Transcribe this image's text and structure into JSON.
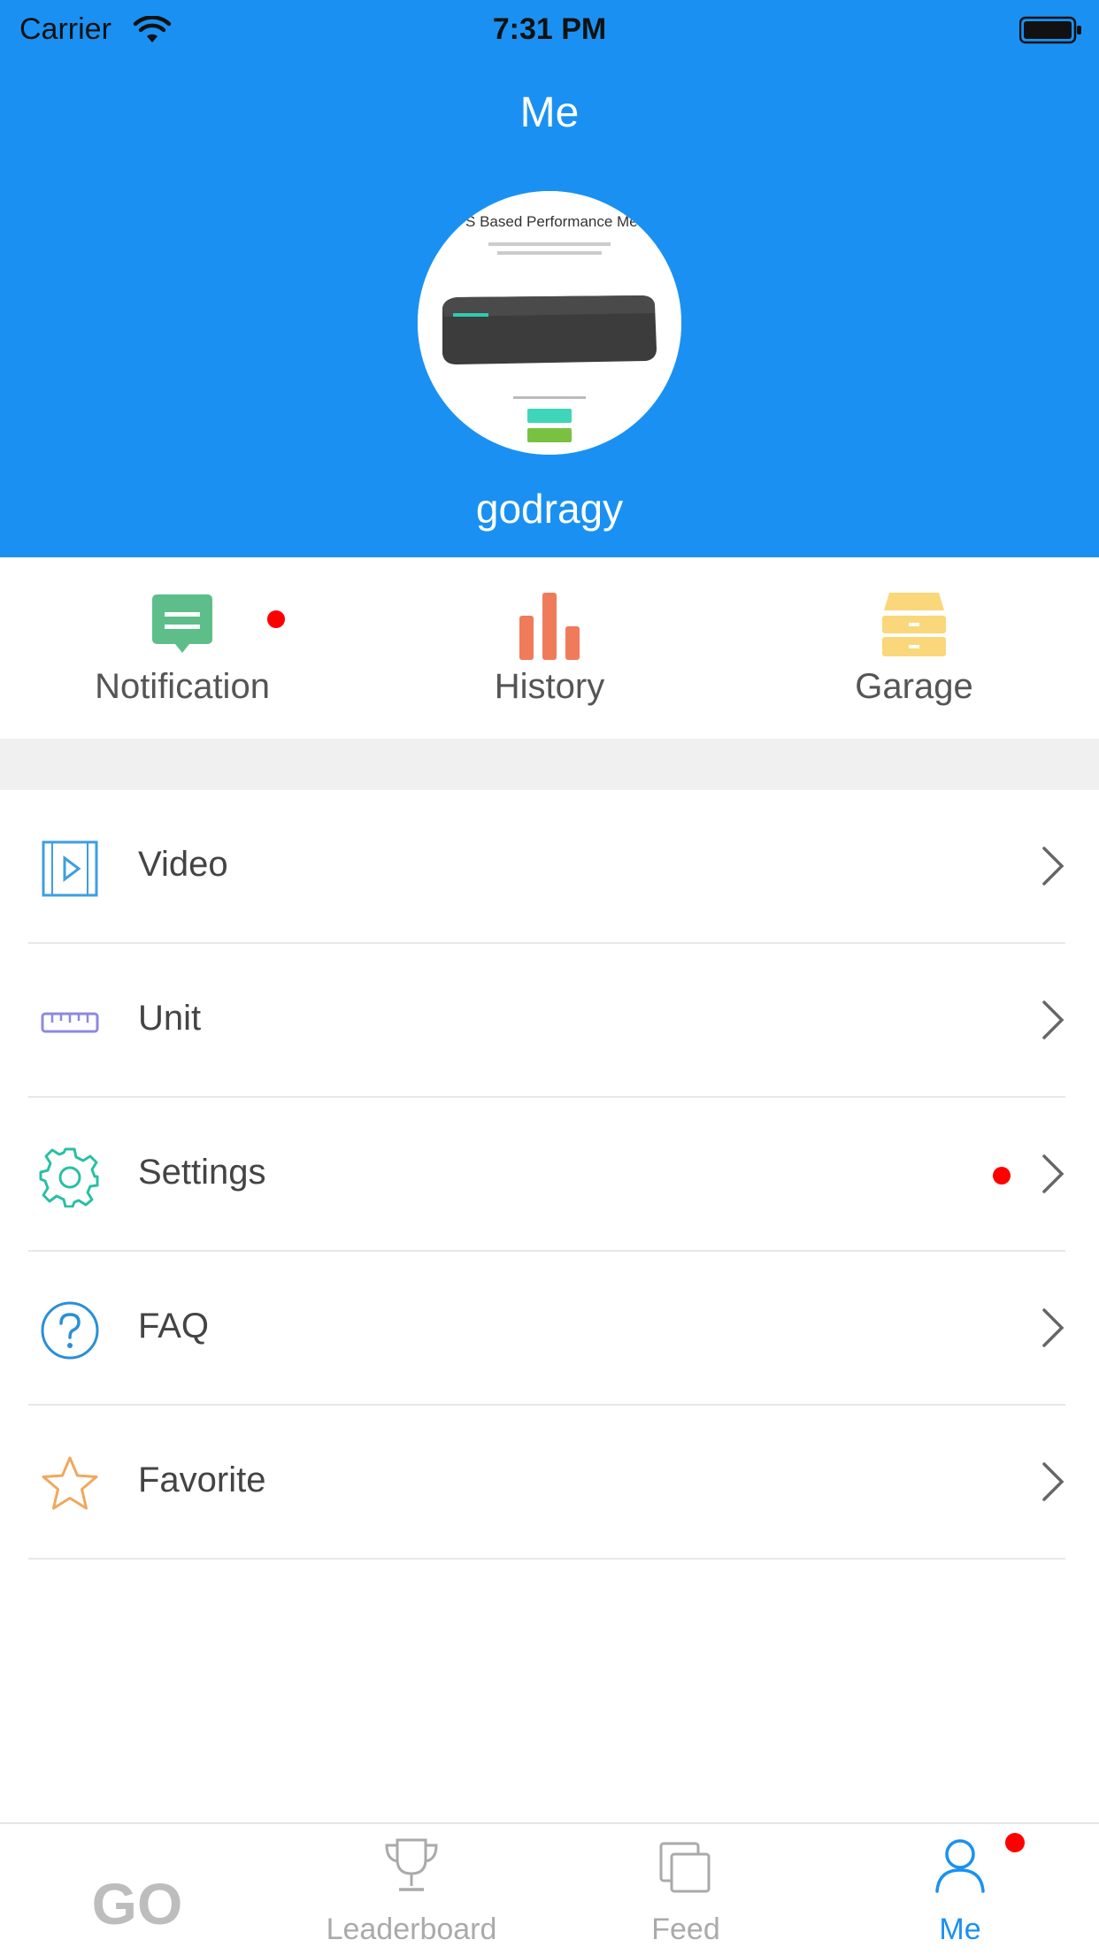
{
  "status_bar": {
    "carrier": "Carrier",
    "time": "7:31 PM"
  },
  "header": {
    "title": "Me",
    "username": "godragy",
    "avatar_caption": "GPS Based Performance Meter"
  },
  "quick_actions": [
    {
      "label": "Notification",
      "icon": "chat-bubble-icon",
      "color": "#5DBE8A",
      "has_badge": true
    },
    {
      "label": "History",
      "icon": "bar-chart-icon",
      "color": "#F07B5B",
      "has_badge": false
    },
    {
      "label": "Garage",
      "icon": "drawer-icon",
      "color": "#F9D77A",
      "has_badge": false
    }
  ],
  "menu": [
    {
      "label": "Video",
      "icon": "video-icon",
      "color": "#3D9FE0",
      "has_badge": false
    },
    {
      "label": "Unit",
      "icon": "ruler-icon",
      "color": "#8E88E0",
      "has_badge": false
    },
    {
      "label": "Settings",
      "icon": "gear-icon",
      "color": "#2ABFA4",
      "has_badge": true
    },
    {
      "label": "FAQ",
      "icon": "question-icon",
      "color": "#2A8FD8",
      "has_badge": false
    },
    {
      "label": "Favorite",
      "icon": "star-icon",
      "color": "#F0A85C",
      "has_badge": false
    }
  ],
  "tab_bar": {
    "tabs": [
      {
        "label": "GO",
        "icon": "go-text-icon",
        "active": false
      },
      {
        "label": "Leaderboard",
        "icon": "trophy-icon",
        "active": false
      },
      {
        "label": "Feed",
        "icon": "feed-icon",
        "active": false
      },
      {
        "label": "Me",
        "icon": "person-icon",
        "active": true,
        "has_badge": true
      }
    ]
  },
  "colors": {
    "primary": "#1A91F2",
    "badge": "#FF0000",
    "separator": "#E8E8E8"
  }
}
